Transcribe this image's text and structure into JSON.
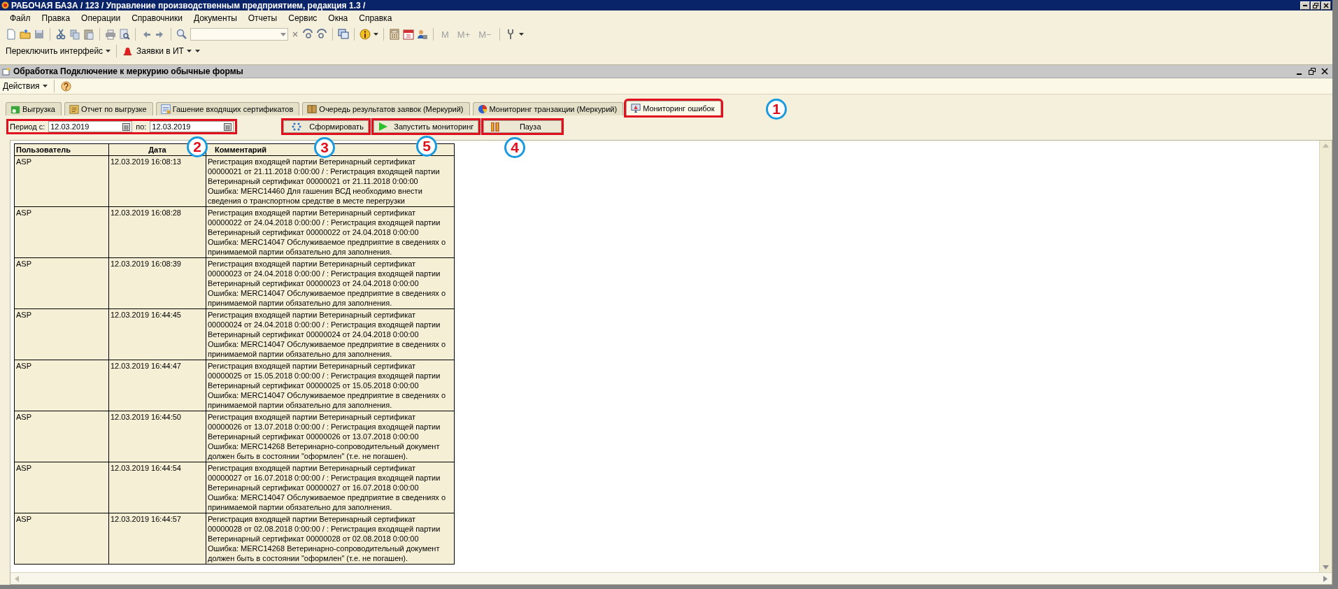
{
  "window": {
    "title": "РАБОЧАЯ БАЗА / 123 /  Управление производственным предприятием, редакция 1.3 /"
  },
  "menu": [
    "Файл",
    "Правка",
    "Операции",
    "Справочники",
    "Документы",
    "Отчеты",
    "Сервис",
    "Окна",
    "Справка"
  ],
  "toolbar": {
    "memory_buttons": [
      {
        "label": "M",
        "disabled": true
      },
      {
        "label": "M+",
        "disabled": true
      },
      {
        "label": "M−",
        "disabled": true
      }
    ]
  },
  "toolbar2": {
    "switch_interface": "Переключить интерфейс",
    "requests": "Заявки в ИТ"
  },
  "form": {
    "title": "Обработка  Подключение к меркурию обычные формы",
    "actions": "Действия",
    "tabs": [
      {
        "label": "Выгрузка",
        "kind": "upload",
        "selected": false,
        "highlighted": false
      },
      {
        "label": "Отчет по выгрузке",
        "kind": "report",
        "selected": false,
        "highlighted": false
      },
      {
        "label": "Гашение входящих сертификатов",
        "kind": "certificate",
        "selected": false,
        "highlighted": false
      },
      {
        "label": "Очередь результатов заявок (Меркурий)",
        "kind": "queue",
        "selected": false,
        "highlighted": false
      },
      {
        "label": "Мониторинг транзакции (Меркурий)",
        "kind": "pie",
        "selected": false,
        "highlighted": false
      },
      {
        "label": "Мониторинг ошибок",
        "kind": "monitor",
        "selected": true,
        "highlighted": true
      }
    ],
    "period": {
      "from_label": "Период с:",
      "from": "12.03.2019",
      "to_label": "по:",
      "to": "12.03.2019",
      "highlighted": true
    },
    "buttons": [
      {
        "label": "Сформировать",
        "kind": "generate",
        "highlighted": true
      },
      {
        "label": "Запустить мониторинг",
        "kind": "start",
        "highlighted": true
      },
      {
        "label": "Пауза",
        "kind": "pause",
        "highlighted": true
      }
    ],
    "callouts": [
      "1",
      "2",
      "3",
      "5",
      "4"
    ],
    "table": {
      "columns": [
        "Пользователь",
        "Дата",
        "Комментарий"
      ],
      "rows": [
        {
          "user": "ASP",
          "date": "12.03.2019 16:08:13",
          "comment": [
            "Регистрация входящей партии Ветеринарный сертификат",
            "00000021 от 21.11.2018 0:00:00 / : Регистрация входящей партии",
            "Ветеринарный сертификат 00000021 от 21.11.2018 0:00:00",
            "Ошибка: MERC14460 Для гашения ВСД необходимо внести",
            "сведения о транспортном средстве в месте перегрузки"
          ]
        },
        {
          "user": "ASP",
          "date": "12.03.2019 16:08:28",
          "comment": [
            "Регистрация входящей партии Ветеринарный сертификат",
            "00000022 от 24.04.2018 0:00:00 / : Регистрация входящей партии",
            "Ветеринарный сертификат 00000022 от 24.04.2018 0:00:00",
            "Ошибка: MERC14047 Обслуживаемое предприятие в сведениях о",
            "принимаемой партии обязательно для заполнения."
          ]
        },
        {
          "user": "ASP",
          "date": "12.03.2019 16:08:39",
          "comment": [
            "Регистрация входящей партии Ветеринарный сертификат",
            "00000023 от 24.04.2018 0:00:00 / : Регистрация входящей партии",
            "Ветеринарный сертификат 00000023 от 24.04.2018 0:00:00",
            "Ошибка: MERC14047 Обслуживаемое предприятие в сведениях о",
            "принимаемой партии обязательно для заполнения."
          ]
        },
        {
          "user": "ASP",
          "date": "12.03.2019 16:44:45",
          "comment": [
            "Регистрация входящей партии Ветеринарный сертификат",
            "00000024 от 24.04.2018 0:00:00 / : Регистрация входящей партии",
            "Ветеринарный сертификат 00000024 от 24.04.2018 0:00:00",
            "Ошибка: MERC14047 Обслуживаемое предприятие в сведениях о",
            "принимаемой партии обязательно для заполнения."
          ]
        },
        {
          "user": "ASP",
          "date": "12.03.2019 16:44:47",
          "comment": [
            "Регистрация входящей партии Ветеринарный сертификат",
            "00000025 от 15.05.2018 0:00:00 / : Регистрация входящей партии",
            "Ветеринарный сертификат 00000025 от 15.05.2018 0:00:00",
            "Ошибка: MERC14047 Обслуживаемое предприятие в сведениях о",
            "принимаемой партии обязательно для заполнения."
          ]
        },
        {
          "user": "ASP",
          "date": "12.03.2019 16:44:50",
          "comment": [
            "Регистрация входящей партии Ветеринарный сертификат",
            "00000026 от 13.07.2018 0:00:00 / : Регистрация входящей партии",
            "Ветеринарный сертификат 00000026 от 13.07.2018 0:00:00",
            "Ошибка: MERC14268 Ветеринарно-сопроводительный документ",
            "должен быть в состоянии \"оформлен\" (т.е. не погашен)."
          ]
        },
        {
          "user": "ASP",
          "date": "12.03.2019 16:44:54",
          "comment": [
            "Регистрация входящей партии Ветеринарный сертификат",
            "00000027 от 16.07.2018 0:00:00 / : Регистрация входящей партии",
            "Ветеринарный сертификат 00000027 от 16.07.2018 0:00:00",
            "Ошибка: MERC14047 Обслуживаемое предприятие в сведениях о",
            "принимаемой партии обязательно для заполнения."
          ]
        },
        {
          "user": "ASP",
          "date": "12.03.2019 16:44:57",
          "comment": [
            "Регистрация входящей партии Ветеринарный сертификат",
            "00000028 от 02.08.2018 0:00:00 / : Регистрация входящей партии",
            "Ветеринарный сертификат 00000028 от 02.08.2018 0:00:00",
            "Ошибка: MERC14268 Ветеринарно-сопроводительный документ",
            "должен быть в состоянии \"оформлен\" (т.е. не погашен)."
          ]
        }
      ]
    }
  }
}
